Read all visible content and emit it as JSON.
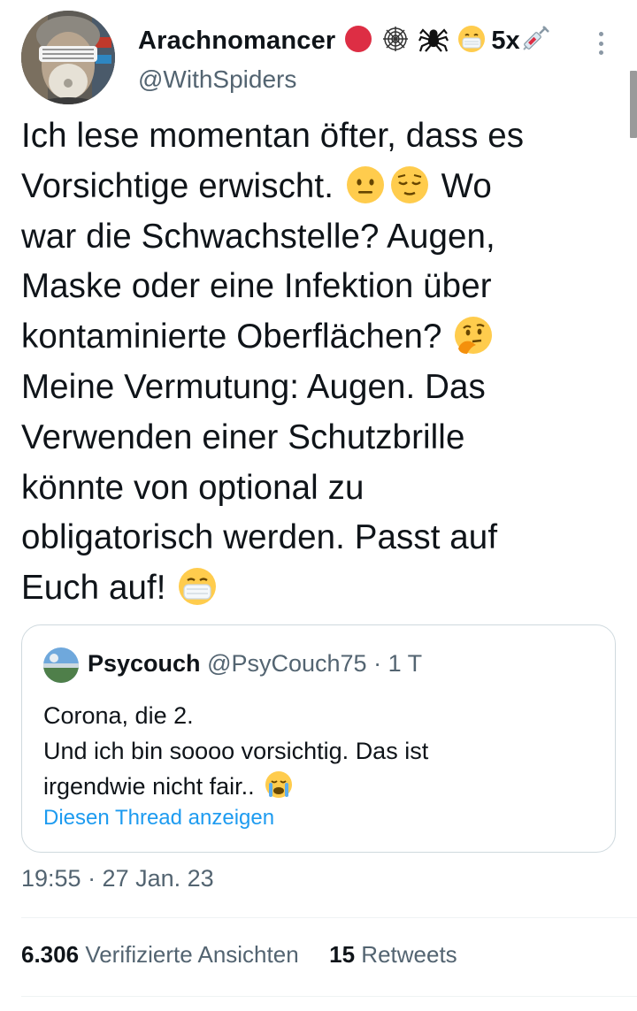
{
  "author": {
    "display_name": "Arachnomancer",
    "name_suffix": "5x",
    "name_icons": [
      "red-circle-icon",
      "spider-web-icon",
      "spider-icon",
      "mask-face-icon",
      "syringe-icon"
    ],
    "handle": "@WithSpiders"
  },
  "tweet": {
    "lines": [
      "Ich lese momentan öfter, dass es",
      "Vorsichtige erwischt.",
      "Wo",
      "war die Schwachstelle? Augen,",
      "Maske oder eine Infektion über",
      "kontaminierte Oberflächen?",
      "Meine Vermutung: Augen. Das",
      "Verwenden einer Schutzbrille",
      "könnte von optional zu",
      "obligatorisch werden. Passt auf",
      "Euch auf!"
    ],
    "emojis": [
      "neutral-face-icon",
      "relieved-face-icon",
      "thinking-face-icon",
      "mask-face-icon"
    ]
  },
  "quote": {
    "name": "Psycouch",
    "handle": "@PsyCouch75",
    "separator": " · ",
    "time": "1 T",
    "lines": [
      "Corona, die 2.",
      "Und ich bin soooo vorsichtig. Das ist",
      "irgendwie nicht fair.."
    ],
    "emoji": "crying-face-icon",
    "link": "Diesen Thread anzeigen"
  },
  "meta": {
    "timestamp": "19:55 · 27 Jan. 23"
  },
  "stats": {
    "views_count": "6.306",
    "views_label": "Verifizierte Ansichten",
    "retweets_count": "15",
    "retweets_label": "Retweets"
  },
  "colors": {
    "text": "#0f1419",
    "secondary": "#536471",
    "link": "#1d9bf0",
    "border": "#cfd9de"
  }
}
